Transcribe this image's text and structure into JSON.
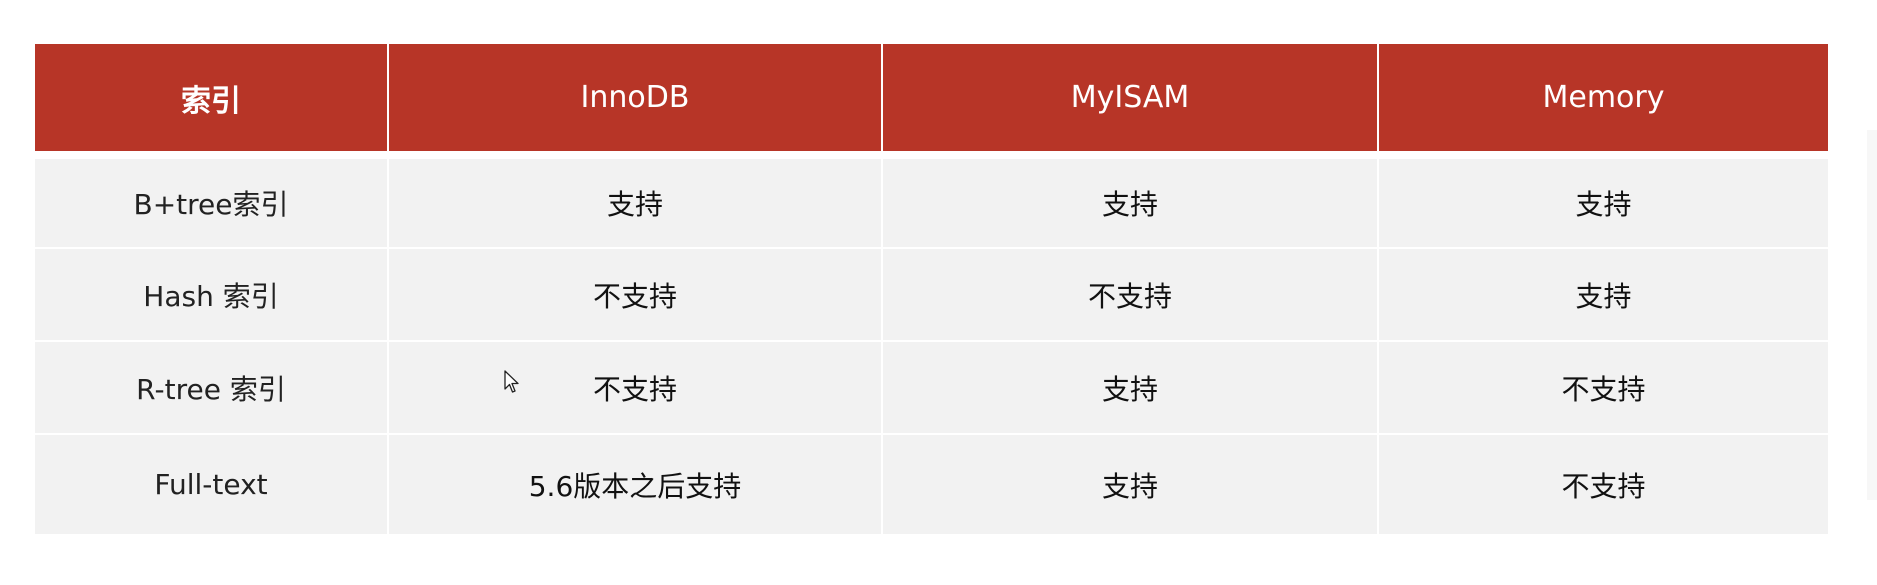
{
  "table": {
    "headers": [
      "索引",
      "InnoDB",
      "MyISAM",
      "Memory"
    ],
    "rows": [
      [
        "B+tree索引",
        "支持",
        "支持",
        "支持"
      ],
      [
        "Hash 索引",
        "不支持",
        "不支持",
        "支持"
      ],
      [
        "R-tree 索引",
        "不支持",
        "支持",
        "不支持"
      ],
      [
        "Full-text",
        "5.6版本之后支持",
        "支持",
        "不支持"
      ]
    ]
  },
  "colors": {
    "header_bg": "#b73527",
    "header_text": "#ffffff",
    "cell_bg": "#f2f2f2",
    "cell_text": "#111111"
  },
  "cursor": {
    "icon": "arrow-pointer-icon"
  }
}
